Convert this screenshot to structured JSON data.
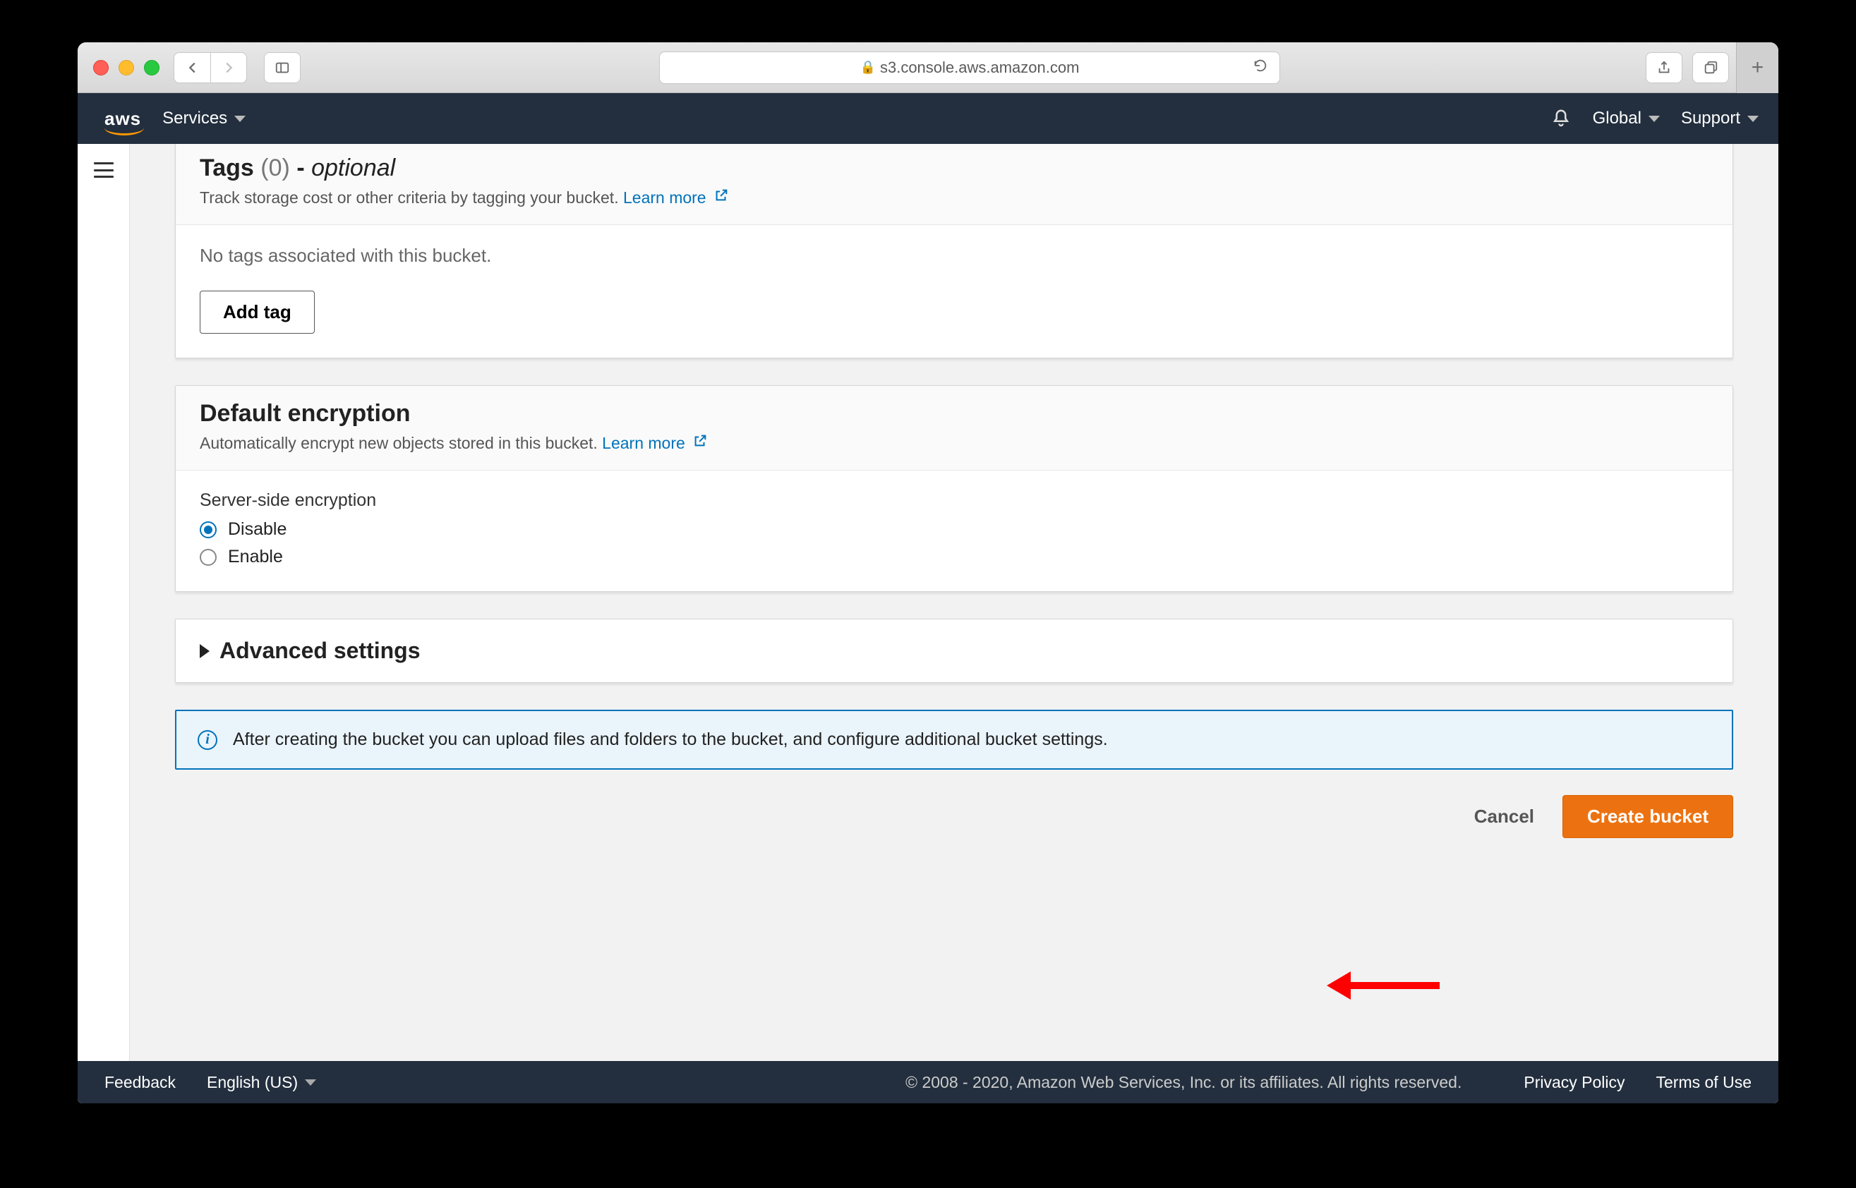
{
  "browser": {
    "url": "s3.console.aws.amazon.com"
  },
  "top": {
    "services": "Services",
    "global": "Global",
    "support": "Support"
  },
  "tags": {
    "title": "Tags",
    "count": "(0)",
    "dash": " - ",
    "optional": "optional",
    "desc": "Track storage cost or other criteria by tagging your bucket. ",
    "learn": "Learn more",
    "empty": "No tags associated with this bucket.",
    "add_btn": "Add tag"
  },
  "encryption": {
    "title": "Default encryption",
    "desc": "Automatically encrypt new objects stored in this bucket. ",
    "learn": "Learn more",
    "field": "Server-side encryption",
    "opt_disable": "Disable",
    "opt_enable": "Enable"
  },
  "advanced": {
    "title": "Advanced settings"
  },
  "infobox": {
    "text": "After creating the bucket you can upload files and folders to the bucket, and configure additional bucket settings."
  },
  "actions": {
    "cancel": "Cancel",
    "create": "Create bucket"
  },
  "footer": {
    "feedback": "Feedback",
    "language": "English (US)",
    "copyright": "© 2008 - 2020, Amazon Web Services, Inc. or its affiliates. All rights reserved.",
    "privacy": "Privacy Policy",
    "terms": "Terms of Use"
  }
}
